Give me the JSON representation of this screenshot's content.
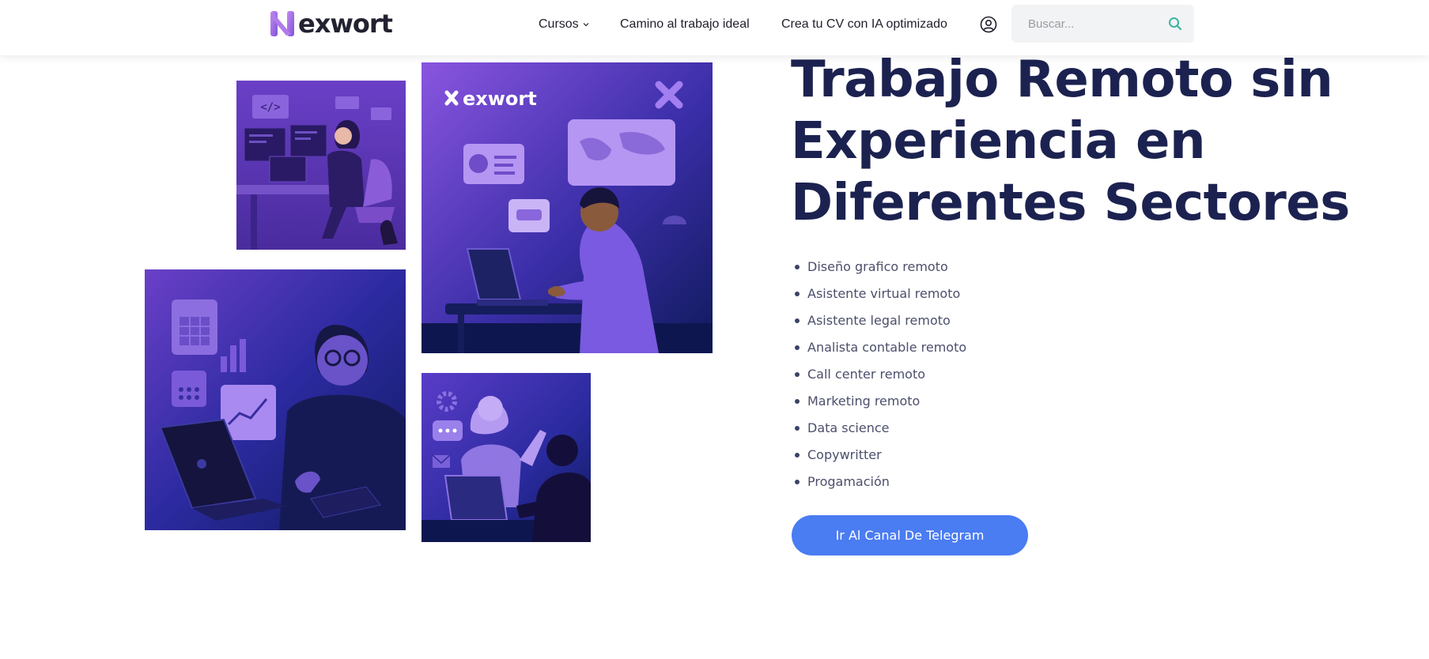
{
  "header": {
    "logo_text": "exwort",
    "nav": {
      "cursos": "Cursos",
      "camino": "Camino al trabajo ideal",
      "crea_cv": "Crea tu CV con IA optimizado"
    },
    "search_placeholder": "Buscar..."
  },
  "illustrations": {
    "main_card_logo": "exwort"
  },
  "hero": {
    "title": "Trabajo Remoto sin Experiencia en Diferentes Sectores",
    "sectors": [
      "Diseño grafico remoto",
      "Asistente virtual remoto",
      "Asistente legal remoto",
      "Analista contable remoto",
      "Call center remoto",
      "Marketing remoto",
      "Data science",
      "Copywritter",
      "Progamación"
    ],
    "cta_label": "Ir Al Canal De Telegram"
  },
  "colors": {
    "title": "#1c2250",
    "cta": "#4a7cf2",
    "search_icon": "#3bb5a0",
    "logo_mark": "#a06be0",
    "card_purple": "#7a4fd6",
    "card_navy": "#13165e"
  },
  "icons": [
    "exwort-logo-icon",
    "chevron-down-icon",
    "user-circle-icon",
    "search-icon"
  ]
}
